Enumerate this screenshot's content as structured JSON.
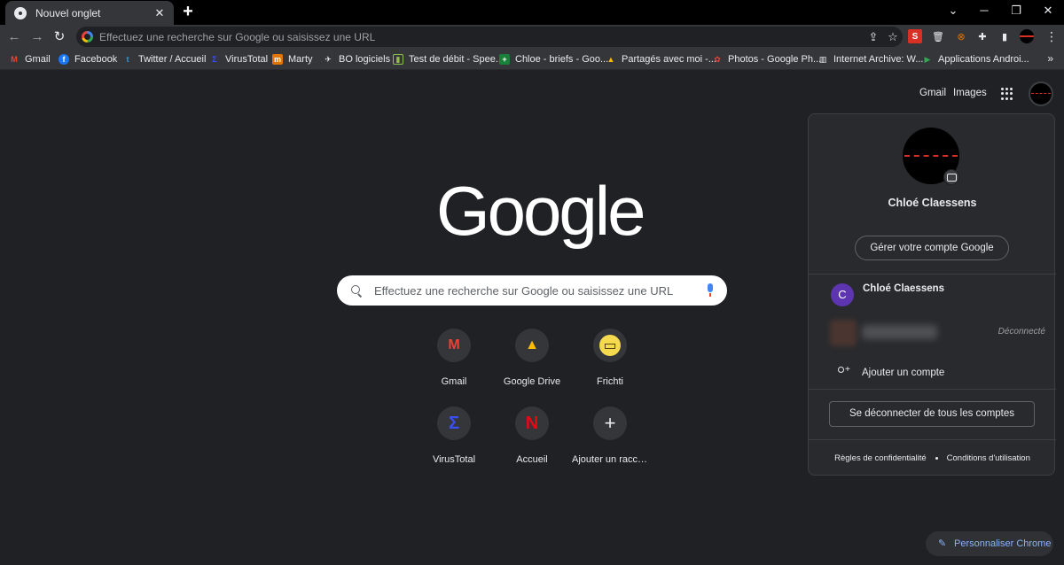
{
  "tab": {
    "title": "Nouvel onglet",
    "close": "✕"
  },
  "window": {
    "minimize": "─",
    "maximize": "❐",
    "close": "✕",
    "expand": "⌄"
  },
  "toolbar": {
    "back": "←",
    "forward": "→",
    "reload": "↻",
    "omnibox_placeholder": "Effectuez une recherche sur Google ou saisissez une URL",
    "share": "⇪",
    "star": "☆",
    "menu": "⋮"
  },
  "bookmarks": [
    {
      "label": "Gmail",
      "icon": "gmail-icon",
      "color": "#ea4335",
      "glyph": "M"
    },
    {
      "label": "Facebook",
      "icon": "facebook-icon",
      "color": "#1877f2",
      "glyph": "f"
    },
    {
      "label": "Twitter / Accueil",
      "icon": "twitter-icon",
      "color": "#1d9bf0",
      "glyph": "t"
    },
    {
      "label": "VirusTotal",
      "icon": "virustotal-icon",
      "color": "#394eff",
      "glyph": "Σ"
    },
    {
      "label": "Marty",
      "icon": "marty-icon",
      "color": "#e37400",
      "glyph": "m"
    },
    {
      "label": "BO logiciels",
      "icon": "bo-icon",
      "color": "#35363a",
      "glyph": "✈"
    },
    {
      "label": "Test de débit - Spee...",
      "icon": "speedtest-icon",
      "color": "#0d2c0d",
      "glyph": "▮"
    },
    {
      "label": "Chloe - briefs - Goo...",
      "icon": "sheets-icon",
      "color": "#188038",
      "glyph": "+"
    },
    {
      "label": "Partagés avec moi -...",
      "icon": "drive-icon",
      "color": "#1a73e8",
      "glyph": "▲"
    },
    {
      "label": "Photos - Google Ph...",
      "icon": "photos-icon",
      "color": "#fbbc04",
      "glyph": "✿"
    },
    {
      "label": "Internet Archive: W...",
      "icon": "archive-icon",
      "color": "#5f6368",
      "glyph": "▥"
    },
    {
      "label": "Applications Androi...",
      "icon": "play-icon",
      "color": "#34a853",
      "glyph": "▶"
    }
  ],
  "bookmarks_more": "»",
  "page": {
    "top_links": {
      "gmail": "Gmail",
      "images": "Images"
    },
    "logo": "Google",
    "search_placeholder": "Effectuez une recherche sur Google ou saisissez une URL",
    "shortcuts": [
      {
        "label": "Gmail",
        "icon": "gmail-icon",
        "glyph": "M",
        "color": "#ea4335"
      },
      {
        "label": "Google Drive",
        "icon": "drive-icon",
        "glyph": "▲",
        "color": "#fbbc04"
      },
      {
        "label": "Frichti",
        "icon": "frichti-icon",
        "glyph": "▭",
        "color": "#f5d94e"
      },
      {
        "label": "VirusTotal",
        "icon": "virustotal-icon",
        "glyph": "Σ",
        "color": "#394eff"
      },
      {
        "label": "Accueil",
        "icon": "netflix-icon",
        "glyph": "N",
        "color": "#e50914"
      },
      {
        "label": "Ajouter un raccourci",
        "icon": "add-icon",
        "glyph": "+",
        "color": "#e8eaed"
      }
    ],
    "customize": "Personnaliser Chrome"
  },
  "account": {
    "name": "Chloé Claessens",
    "manage": "Gérer votre compte Google",
    "accounts": [
      {
        "initial": "C",
        "name": "Chloé Claessens"
      }
    ],
    "disconnected_label": "Déconnecté",
    "add_account": "Ajouter un compte",
    "sign_out_all": "Se déconnecter de tous les comptes",
    "privacy": "Règles de confidentialité",
    "terms": "Conditions d'utilisation"
  },
  "colors": {
    "page_bg": "#202124",
    "toolbar_bg": "#35363a",
    "accent": "#8ab4f8",
    "panel_bg": "#292a2d"
  }
}
